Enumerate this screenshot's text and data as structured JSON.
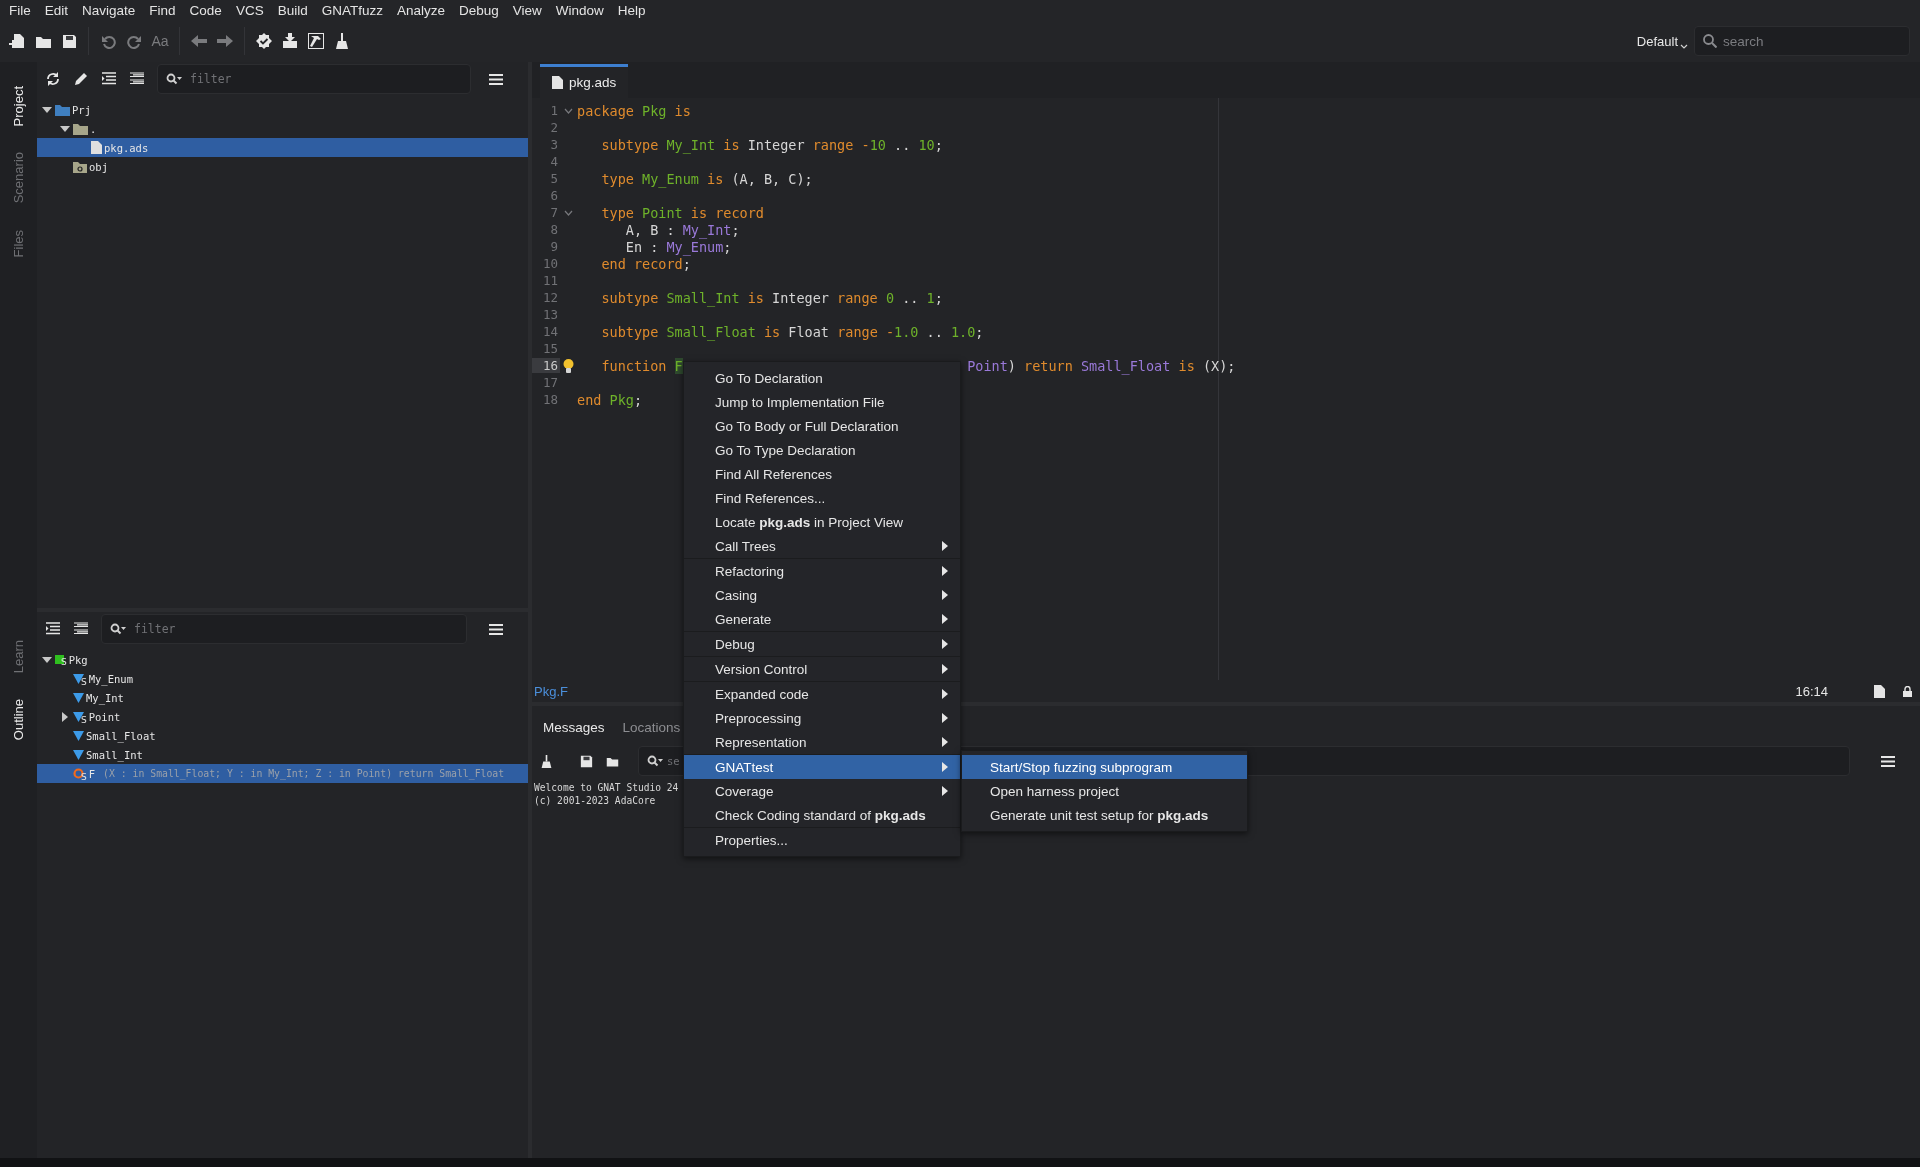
{
  "menu_bar": [
    "File",
    "Edit",
    "Navigate",
    "Find",
    "Code",
    "VCS",
    "Build",
    "GNATfuzz",
    "Analyze",
    "Debug",
    "View",
    "Window",
    "Help"
  ],
  "toolbar": [
    {
      "kind": "new-file",
      "disabled": false
    },
    {
      "kind": "open",
      "disabled": false
    },
    {
      "kind": "save",
      "disabled": false
    },
    {
      "kind": "separator"
    },
    {
      "kind": "undo",
      "disabled": true
    },
    {
      "kind": "redo",
      "disabled": true
    },
    {
      "kind": "text",
      "label": "Aa",
      "disabled": true
    },
    {
      "kind": "separator"
    },
    {
      "kind": "back",
      "disabled": true
    },
    {
      "kind": "forward",
      "disabled": true
    },
    {
      "kind": "separator"
    },
    {
      "kind": "check",
      "disabled": false
    },
    {
      "kind": "install",
      "disabled": false
    },
    {
      "kind": "build",
      "disabled": false
    },
    {
      "kind": "clean",
      "disabled": false
    }
  ],
  "perspective": {
    "label": "Default"
  },
  "search": {
    "placeholder": "search"
  },
  "side_tabs_top": [
    {
      "label": "Project",
      "selected": true
    },
    {
      "label": "Scenario",
      "selected": false
    },
    {
      "label": "Files",
      "selected": false
    }
  ],
  "side_tabs_bottom": [
    {
      "label": "Learn",
      "selected": false
    },
    {
      "label": "Outline",
      "selected": true
    }
  ],
  "project": {
    "filter": {
      "placeholder": "filter"
    },
    "tree": [
      {
        "label": "Prj",
        "kind": "project",
        "expanded": true,
        "selected": false,
        "children": [
          {
            "label": ".",
            "kind": "folder",
            "expanded": true,
            "selected": false,
            "children": [
              {
                "label": "pkg.ads",
                "kind": "file",
                "selected": true
              }
            ]
          },
          {
            "label": "obj",
            "kind": "obj-folder",
            "selected": false
          }
        ]
      }
    ]
  },
  "outline": {
    "filter": {
      "placeholder": "filter"
    },
    "tree": [
      {
        "label": "Pkg",
        "kind": "package",
        "badge": "S",
        "expanded": true,
        "selected": false,
        "children": [
          {
            "label": "My_Enum",
            "kind": "type",
            "badge": "S",
            "selected": false
          },
          {
            "label": "My_Int",
            "kind": "type",
            "selected": false
          },
          {
            "label": "Point",
            "kind": "type",
            "badge": "S",
            "expanded": false,
            "selected": false
          },
          {
            "label": "Small_Float",
            "kind": "type",
            "selected": false
          },
          {
            "label": "Small_Int",
            "kind": "type",
            "selected": false
          },
          {
            "label": "F",
            "detail": "(X : in Small_Float; Y : in My_Int; Z : in Point) return Small_Float",
            "kind": "function",
            "badge": "S",
            "selected": true
          }
        ]
      }
    ]
  },
  "editor": {
    "tabs": [
      {
        "label": "pkg.ads",
        "selected": true
      }
    ],
    "lines": [
      {
        "number": "1",
        "fold": true,
        "current": false,
        "hint": false,
        "tokens": [
          {
            "kind": "kw",
            "text": "package "
          },
          {
            "kind": "name",
            "text": "Pkg "
          },
          {
            "kind": "kw",
            "text": "is"
          }
        ]
      },
      {
        "number": "2",
        "fold": false,
        "current": false,
        "hint": false
      },
      {
        "number": "3",
        "fold": false,
        "current": false,
        "hint": false,
        "indent": true,
        "tokens": [
          {
            "kind": "kw",
            "text": "subtype "
          },
          {
            "kind": "name",
            "text": "My_Int "
          },
          {
            "kind": "kw",
            "text": "is "
          },
          {
            "kind": "p",
            "text": "Integer "
          },
          {
            "kind": "kw",
            "text": "range -"
          },
          {
            "kind": "num",
            "text": "10"
          },
          {
            "kind": "p",
            "text": " .. "
          },
          {
            "kind": "num",
            "text": "10"
          },
          {
            "kind": "p",
            "text": ";"
          }
        ]
      },
      {
        "number": "4",
        "fold": false,
        "current": false,
        "hint": false
      },
      {
        "number": "5",
        "fold": false,
        "current": false,
        "hint": false,
        "indent": true,
        "tokens": [
          {
            "kind": "kw",
            "text": "type "
          },
          {
            "kind": "name",
            "text": "My_Enum "
          },
          {
            "kind": "kw",
            "text": "is "
          },
          {
            "kind": "p",
            "text": "(A, B, C);"
          }
        ]
      },
      {
        "number": "6",
        "fold": false,
        "current": false,
        "hint": false
      },
      {
        "number": "7",
        "fold": true,
        "current": false,
        "hint": false,
        "indent": true,
        "tokens": [
          {
            "kind": "kw",
            "text": "type "
          },
          {
            "kind": "name",
            "text": "Point "
          },
          {
            "kind": "kw",
            "text": "is record"
          }
        ]
      },
      {
        "number": "8",
        "fold": false,
        "current": false,
        "hint": false,
        "indent": true,
        "tokens": [
          {
            "kind": "p",
            "text": "   A, B : "
          },
          {
            "kind": "type",
            "text": "My_Int"
          },
          {
            "kind": "p",
            "text": ";"
          }
        ]
      },
      {
        "number": "9",
        "fold": false,
        "current": false,
        "hint": false,
        "indent": true,
        "tokens": [
          {
            "kind": "p",
            "text": "   En : "
          },
          {
            "kind": "type",
            "text": "My_Enum"
          },
          {
            "kind": "p",
            "text": ";"
          }
        ]
      },
      {
        "number": "10",
        "fold": false,
        "current": false,
        "hint": false,
        "indent": true,
        "tokens": [
          {
            "kind": "kw",
            "text": "end record"
          },
          {
            "kind": "p",
            "text": ";"
          }
        ]
      },
      {
        "number": "11",
        "fold": false,
        "current": false,
        "hint": false
      },
      {
        "number": "12",
        "fold": false,
        "current": false,
        "hint": false,
        "indent": true,
        "tokens": [
          {
            "kind": "kw",
            "text": "subtype "
          },
          {
            "kind": "name",
            "text": "Small_Int "
          },
          {
            "kind": "kw",
            "text": "is "
          },
          {
            "kind": "p",
            "text": "Integer "
          },
          {
            "kind": "kw",
            "text": "range "
          },
          {
            "kind": "num",
            "text": "0"
          },
          {
            "kind": "p",
            "text": " .. "
          },
          {
            "kind": "num",
            "text": "1"
          },
          {
            "kind": "p",
            "text": ";"
          }
        ]
      },
      {
        "number": "13",
        "fold": false,
        "current": false,
        "hint": false
      },
      {
        "number": "14",
        "fold": false,
        "current": false,
        "hint": false,
        "indent": true,
        "tokens": [
          {
            "kind": "kw",
            "text": "subtype "
          },
          {
            "kind": "name",
            "text": "Small_Float "
          },
          {
            "kind": "kw",
            "text": "is "
          },
          {
            "kind": "p",
            "text": "Float "
          },
          {
            "kind": "kw",
            "text": "range -"
          },
          {
            "kind": "num",
            "text": "1.0"
          },
          {
            "kind": "p",
            "text": " .. "
          },
          {
            "kind": "num",
            "text": "1.0"
          },
          {
            "kind": "p",
            "text": ";"
          }
        ]
      },
      {
        "number": "15",
        "fold": false,
        "current": false,
        "hint": false
      },
      {
        "number": "16",
        "fold": false,
        "current": true,
        "hint": true,
        "indent": true,
        "tokens": [
          {
            "kind": "kw",
            "text": "function "
          },
          {
            "kind": "cursor",
            "text": "F"
          },
          {
            "kind": "hidden"
          },
          {
            "kind": "type",
            "text": "Point"
          },
          {
            "kind": "p",
            "text": ") "
          },
          {
            "kind": "kw",
            "text": "return "
          },
          {
            "kind": "type",
            "text": "Small_Float "
          },
          {
            "kind": "kw",
            "text": "is "
          },
          {
            "kind": "p",
            "text": "(X);"
          }
        ]
      },
      {
        "number": "17",
        "fold": false,
        "current": false,
        "hint": false
      },
      {
        "number": "18",
        "fold": false,
        "current": false,
        "hint": false,
        "tokens": [
          {
            "kind": "kw",
            "text": "end "
          },
          {
            "kind": "name",
            "text": "Pkg"
          },
          {
            "kind": "p",
            "text": ";"
          }
        ]
      }
    ],
    "location": "Pkg.F",
    "cursor": "16:14"
  },
  "messages": {
    "tabs": [
      {
        "label": "Messages",
        "selected": true
      },
      {
        "label": "Locations",
        "selected": false
      }
    ],
    "filter": {
      "placeholder": "se"
    },
    "lines": [
      "Welcome to GNAT Studio 24",
      "(c) 2001-2023 AdaCore"
    ]
  },
  "context_menu": [
    {
      "kind": "item",
      "label": "Go To Declaration",
      "submenu": false,
      "selected": false
    },
    {
      "kind": "item",
      "label": "Jump to Implementation File",
      "submenu": false,
      "selected": false
    },
    {
      "kind": "item",
      "label": "Go To Body or Full Declaration",
      "submenu": false,
      "selected": false
    },
    {
      "kind": "item",
      "label": "Go To Type Declaration",
      "submenu": false,
      "selected": false
    },
    {
      "kind": "item",
      "label": "Find All References",
      "submenu": false,
      "selected": false
    },
    {
      "kind": "item",
      "label": "Find References...",
      "submenu": false,
      "selected": false
    },
    {
      "kind": "item",
      "label": "Locate **pkg.ads** in Project View",
      "submenu": false,
      "selected": false
    },
    {
      "kind": "item",
      "label": "Call Trees",
      "submenu": true,
      "selected": false
    },
    {
      "kind": "separator"
    },
    {
      "kind": "item",
      "label": "Refactoring",
      "submenu": true,
      "selected": false
    },
    {
      "kind": "item",
      "label": "Casing",
      "submenu": true,
      "selected": false
    },
    {
      "kind": "item",
      "label": "Generate",
      "submenu": true,
      "selected": false
    },
    {
      "kind": "separator"
    },
    {
      "kind": "item",
      "label": "Debug",
      "submenu": true,
      "selected": false
    },
    {
      "kind": "separator"
    },
    {
      "kind": "item",
      "label": "Version Control",
      "submenu": true,
      "selected": false
    },
    {
      "kind": "separator"
    },
    {
      "kind": "item",
      "label": "Expanded code",
      "submenu": true,
      "selected": false
    },
    {
      "kind": "item",
      "label": "Preprocessing",
      "submenu": true,
      "selected": false
    },
    {
      "kind": "item",
      "label": "Representation",
      "submenu": true,
      "selected": false
    },
    {
      "kind": "separator"
    },
    {
      "kind": "item",
      "label": "GNATtest",
      "submenu": true,
      "selected": true
    },
    {
      "kind": "item",
      "label": "Coverage",
      "submenu": true,
      "selected": false
    },
    {
      "kind": "item",
      "label": "Check Coding standard of **pkg.ads**",
      "submenu": false,
      "selected": false
    },
    {
      "kind": "separator"
    },
    {
      "kind": "item",
      "label": "Properties...",
      "submenu": false,
      "selected": false
    }
  ],
  "submenu": [
    {
      "label": "Start/Stop fuzzing subprogram",
      "selected": true
    },
    {
      "label": "Open harness project",
      "selected": false
    },
    {
      "label": "Generate unit test setup for **pkg.ads**",
      "selected": false
    }
  ]
}
